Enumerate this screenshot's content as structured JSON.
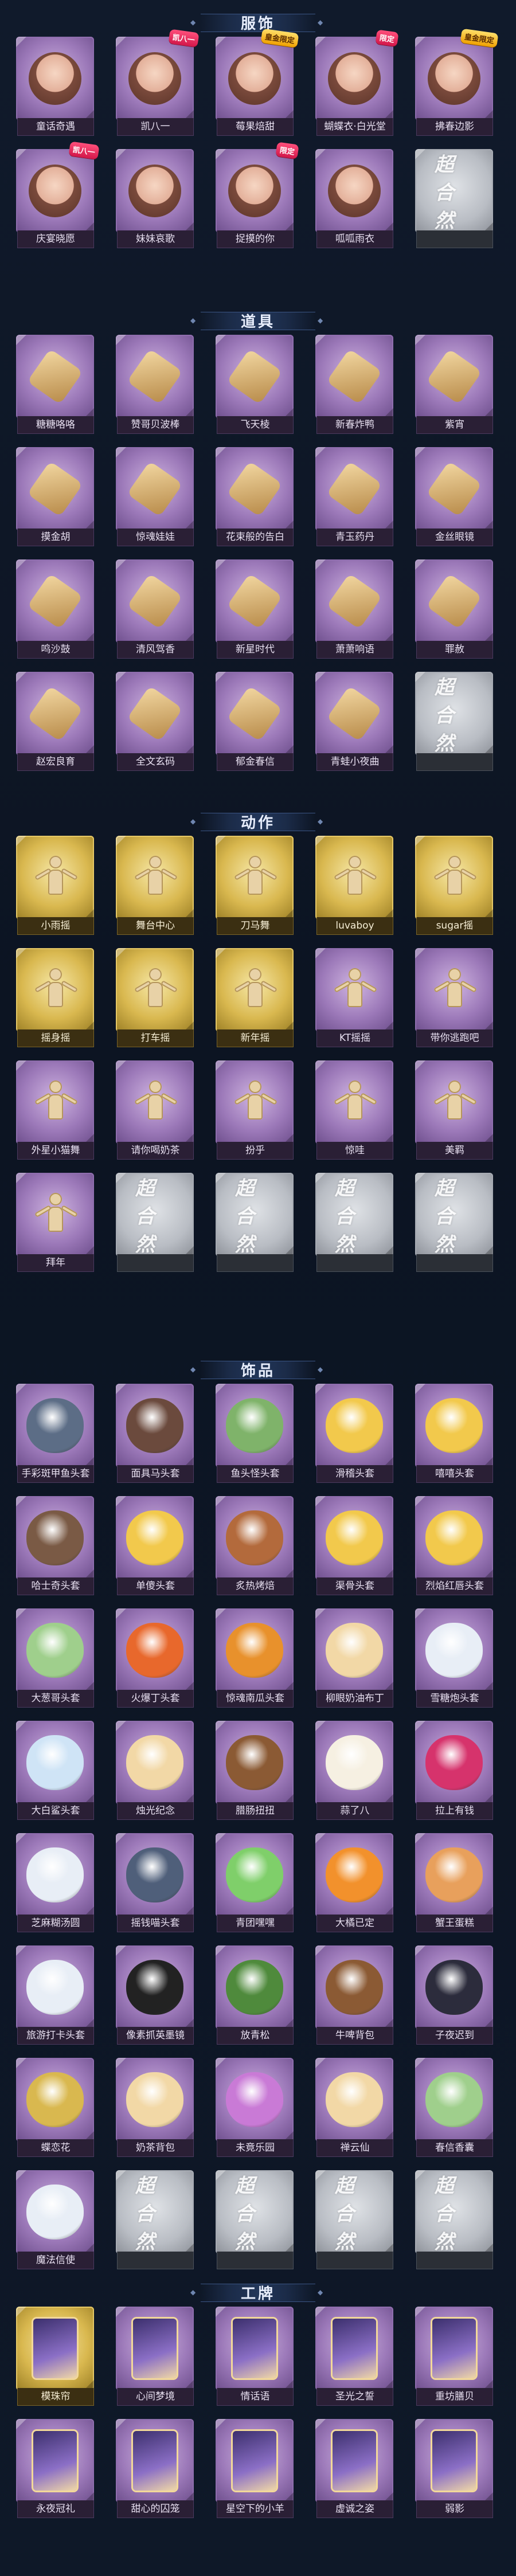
{
  "colors": {
    "background": "#0d1524",
    "purple_card": "#9c79b9",
    "gold_card": "#d9b84f",
    "grey_card": "#b9bdc4"
  },
  "placeholder_text": "超合然",
  "sections": [
    {
      "title": "服饰",
      "items": [
        {
          "label": "童话奇遇",
          "rarity": "purple",
          "art": "face",
          "badge": ""
        },
        {
          "label": "凯八一",
          "rarity": "purple",
          "art": "face",
          "badge": "凯八一"
        },
        {
          "label": "莓果焙甜",
          "rarity": "purple",
          "art": "face",
          "badge": "皇金限定"
        },
        {
          "label": "蝴蝶衣·白光堂",
          "rarity": "purple",
          "art": "face",
          "badge": "限定"
        },
        {
          "label": "拂春边影",
          "rarity": "purple",
          "art": "face",
          "badge": "皇金限定"
        },
        {
          "label": "庆宴晓愿",
          "rarity": "purple",
          "art": "face",
          "badge": "凯八一"
        },
        {
          "label": "妹妹哀歌",
          "rarity": "purple",
          "art": "face",
          "badge": ""
        },
        {
          "label": "捉摸的你",
          "rarity": "purple",
          "art": "face",
          "badge": "限定"
        },
        {
          "label": "呱呱雨衣",
          "rarity": "purple",
          "art": "face",
          "badge": ""
        },
        {
          "label": "",
          "rarity": "grey",
          "art": "placeholder",
          "badge": ""
        }
      ]
    },
    {
      "title": "道具",
      "items": [
        {
          "label": "糖糖咯咯",
          "rarity": "purple",
          "art": "prop"
        },
        {
          "label": "赞哥贝波棒",
          "rarity": "purple",
          "art": "prop"
        },
        {
          "label": "飞天棱",
          "rarity": "purple",
          "art": "prop"
        },
        {
          "label": "新春炸鸭",
          "rarity": "purple",
          "art": "prop"
        },
        {
          "label": "紫宵",
          "rarity": "purple",
          "art": "prop"
        },
        {
          "label": "摸金胡",
          "rarity": "purple",
          "art": "prop"
        },
        {
          "label": "惊魂娃娃",
          "rarity": "purple",
          "art": "prop"
        },
        {
          "label": "花束般的告白",
          "rarity": "purple",
          "art": "prop"
        },
        {
          "label": "青玉药丹",
          "rarity": "purple",
          "art": "prop"
        },
        {
          "label": "金丝眼镜",
          "rarity": "purple",
          "art": "prop"
        },
        {
          "label": "鸣沙鼓",
          "rarity": "purple",
          "art": "prop"
        },
        {
          "label": "清风驾香",
          "rarity": "purple",
          "art": "prop"
        },
        {
          "label": "新星时代",
          "rarity": "purple",
          "art": "prop"
        },
        {
          "label": "萧萧响语",
          "rarity": "purple",
          "art": "prop"
        },
        {
          "label": "罪赦",
          "rarity": "purple",
          "art": "prop"
        },
        {
          "label": "赵宏良育",
          "rarity": "purple",
          "art": "prop"
        },
        {
          "label": "全文玄码",
          "rarity": "purple",
          "art": "prop"
        },
        {
          "label": "郁金春信",
          "rarity": "purple",
          "art": "prop"
        },
        {
          "label": "青蛙小夜曲",
          "rarity": "purple",
          "art": "prop"
        },
        {
          "label": "",
          "rarity": "grey",
          "art": "placeholder"
        }
      ]
    },
    {
      "title": "动作",
      "items": [
        {
          "label": "小雨摇",
          "rarity": "gold",
          "art": "pose"
        },
        {
          "label": "舞台中心",
          "rarity": "gold",
          "art": "pose"
        },
        {
          "label": "刀马舞",
          "rarity": "gold",
          "art": "pose"
        },
        {
          "label": "luvaboy",
          "rarity": "gold",
          "art": "pose"
        },
        {
          "label": "sugar摇",
          "rarity": "gold",
          "art": "pose"
        },
        {
          "label": "摇身摇",
          "rarity": "gold",
          "art": "pose"
        },
        {
          "label": "打车摇",
          "rarity": "gold",
          "art": "pose"
        },
        {
          "label": "新年摇",
          "rarity": "gold",
          "art": "pose"
        },
        {
          "label": "KT摇摇",
          "rarity": "purple",
          "art": "pose"
        },
        {
          "label": "带你逃跑吧",
          "rarity": "purple",
          "art": "pose"
        },
        {
          "label": "外星小猫舞",
          "rarity": "purple",
          "art": "pose"
        },
        {
          "label": "请你喝奶茶",
          "rarity": "purple",
          "art": "pose"
        },
        {
          "label": "扮乎",
          "rarity": "purple",
          "art": "pose"
        },
        {
          "label": "惊哇",
          "rarity": "purple",
          "art": "pose"
        },
        {
          "label": "美羁",
          "rarity": "purple",
          "art": "pose"
        },
        {
          "label": "拜年",
          "rarity": "purple",
          "art": "pose"
        },
        {
          "label": "",
          "rarity": "grey",
          "art": "placeholder"
        },
        {
          "label": "",
          "rarity": "grey",
          "art": "placeholder"
        },
        {
          "label": "",
          "rarity": "grey",
          "art": "placeholder"
        },
        {
          "label": "",
          "rarity": "grey",
          "art": "placeholder"
        }
      ]
    },
    {
      "title": "饰品",
      "items": [
        {
          "label": "手彩斑甲鱼头套",
          "rarity": "purple",
          "art": "head",
          "tone": "#5c6d86"
        },
        {
          "label": "面具马头套",
          "rarity": "purple",
          "art": "head",
          "tone": "#6b4a3d"
        },
        {
          "label": "鱼头怪头套",
          "rarity": "purple",
          "art": "head",
          "tone": "#7fb36a"
        },
        {
          "label": "滑稽头套",
          "rarity": "purple",
          "art": "head",
          "tone": "#f2c94c"
        },
        {
          "label": "嘻嘻头套",
          "rarity": "purple",
          "art": "head",
          "tone": "#f2c94c"
        },
        {
          "label": "哈士奇头套",
          "rarity": "purple",
          "art": "head",
          "tone": "#7a5a45"
        },
        {
          "label": "单傻头套",
          "rarity": "purple",
          "art": "head",
          "tone": "#f2c94c"
        },
        {
          "label": "炙热烤焙",
          "rarity": "purple",
          "art": "head",
          "tone": "#b36a3c"
        },
        {
          "label": "渠骨头套",
          "rarity": "purple",
          "art": "head",
          "tone": "#f2c94c"
        },
        {
          "label": "烈焰红唇头套",
          "rarity": "purple",
          "art": "head",
          "tone": "#f2c94c"
        },
        {
          "label": "大葱哥头套",
          "rarity": "purple",
          "art": "head",
          "tone": "#9fcf8c"
        },
        {
          "label": "火爆丁头套",
          "rarity": "purple",
          "art": "head",
          "tone": "#e8682c"
        },
        {
          "label": "惊魂南瓜头套",
          "rarity": "purple",
          "art": "head",
          "tone": "#e8912c"
        },
        {
          "label": "柳眼奶油布丁",
          "rarity": "purple",
          "art": "head",
          "tone": "#f2d8a6"
        },
        {
          "label": "雪糖炮头套",
          "rarity": "purple",
          "art": "head",
          "tone": "#e8eef6"
        },
        {
          "label": "大白鲨头套",
          "rarity": "purple",
          "art": "head",
          "tone": "#cfe4f6"
        },
        {
          "label": "烛光纪念",
          "rarity": "purple",
          "art": "head",
          "tone": "#f2d8a6"
        },
        {
          "label": "腊肠扭扭",
          "rarity": "purple",
          "art": "head",
          "tone": "#8b5a34"
        },
        {
          "label": "蒜了八",
          "rarity": "purple",
          "art": "head",
          "tone": "#f6f0e2"
        },
        {
          "label": "拉上有钱",
          "rarity": "purple",
          "art": "head",
          "tone": "#d6336c"
        },
        {
          "label": "芝麻糊汤圆",
          "rarity": "purple",
          "art": "head",
          "tone": "#e8eef6"
        },
        {
          "label": "摇钱喵头套",
          "rarity": "purple",
          "art": "head",
          "tone": "#4f5f7a"
        },
        {
          "label": "青团嘿嘿",
          "rarity": "purple",
          "art": "head",
          "tone": "#7fcf6a"
        },
        {
          "label": "大橘已定",
          "rarity": "purple",
          "art": "head",
          "tone": "#f2912c"
        },
        {
          "label": "蟹王蛋糕",
          "rarity": "purple",
          "art": "head",
          "tone": "#e8a05c"
        },
        {
          "label": "旅游打卡头套",
          "rarity": "purple",
          "art": "head",
          "tone": "#e8eef6"
        },
        {
          "label": "像素抓英墨镜",
          "rarity": "purple",
          "art": "head",
          "tone": "#222222"
        },
        {
          "label": "放青松",
          "rarity": "purple",
          "art": "head",
          "tone": "#4f8a3c"
        },
        {
          "label": "牛啤背包",
          "rarity": "purple",
          "art": "head",
          "tone": "#8b5a34"
        },
        {
          "label": "子夜迟到",
          "rarity": "purple",
          "art": "head",
          "tone": "#2c2c3c"
        },
        {
          "label": "蝶恋花",
          "rarity": "purple",
          "art": "head",
          "tone": "#d9b84f"
        },
        {
          "label": "奶茶背包",
          "rarity": "purple",
          "art": "head",
          "tone": "#f2d8a6"
        },
        {
          "label": "未竟乐园",
          "rarity": "purple",
          "art": "head",
          "tone": "#c97ad6"
        },
        {
          "label": "禅云仙",
          "rarity": "purple",
          "art": "head",
          "tone": "#f2d8a6"
        },
        {
          "label": "春信香囊",
          "rarity": "purple",
          "art": "head",
          "tone": "#9fcf8c"
        },
        {
          "label": "魔法信使",
          "rarity": "purple",
          "art": "head",
          "tone": "#e8eef6"
        },
        {
          "label": "",
          "rarity": "grey",
          "art": "placeholder"
        },
        {
          "label": "",
          "rarity": "grey",
          "art": "placeholder"
        },
        {
          "label": "",
          "rarity": "grey",
          "art": "placeholder"
        },
        {
          "label": "",
          "rarity": "grey",
          "art": "placeholder"
        }
      ]
    },
    {
      "title": "工牌",
      "items": [
        {
          "label": "模珠帘",
          "rarity": "gold",
          "art": "card"
        },
        {
          "label": "心间梦境",
          "rarity": "purple",
          "art": "card"
        },
        {
          "label": "情话语",
          "rarity": "purple",
          "art": "card"
        },
        {
          "label": "圣光之誓",
          "rarity": "purple",
          "art": "card"
        },
        {
          "label": "重坊膳贝",
          "rarity": "purple",
          "art": "card"
        },
        {
          "label": "永夜冠礼",
          "rarity": "purple",
          "art": "card"
        },
        {
          "label": "甜心的囚笼",
          "rarity": "purple",
          "art": "card"
        },
        {
          "label": "星空下的小羊",
          "rarity": "purple",
          "art": "card"
        },
        {
          "label": "虚诚之姿",
          "rarity": "purple",
          "art": "card"
        },
        {
          "label": "弱影",
          "rarity": "purple",
          "art": "card"
        }
      ]
    }
  ]
}
